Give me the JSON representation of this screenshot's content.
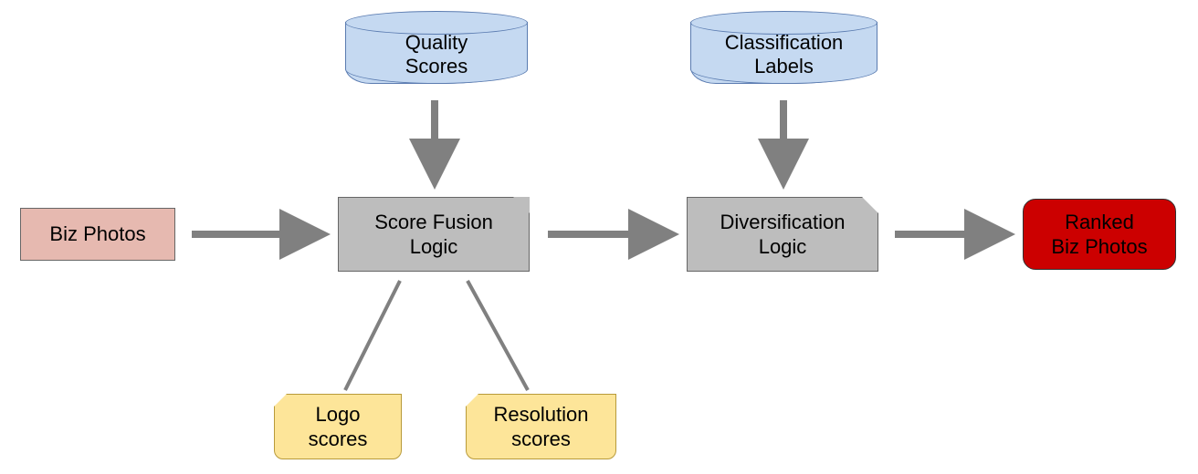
{
  "nodes": {
    "biz_photos": "Biz Photos",
    "quality_scores": "Quality\nScores",
    "classification_labels": "Classification\nLabels",
    "score_fusion": "Score Fusion\nLogic",
    "diversification": "Diversification\nLogic",
    "ranked": "Ranked\nBiz Photos",
    "logo_scores": "Logo\nscores",
    "resolution_scores": "Resolution\nscores"
  },
  "chart_data": {
    "type": "diagram",
    "nodes": [
      {
        "id": "biz_photos",
        "label": "Biz Photos",
        "shape": "rect",
        "color": "#e6b9b0"
      },
      {
        "id": "quality_scores",
        "label": "Quality Scores",
        "shape": "cylinder",
        "color": "#c5d9f1"
      },
      {
        "id": "classification_labels",
        "label": "Classification Labels",
        "shape": "cylinder",
        "color": "#c5d9f1"
      },
      {
        "id": "score_fusion",
        "label": "Score Fusion Logic",
        "shape": "process",
        "color": "#bdbdbd"
      },
      {
        "id": "diversification",
        "label": "Diversification Logic",
        "shape": "process",
        "color": "#bdbdbd"
      },
      {
        "id": "ranked",
        "label": "Ranked Biz Photos",
        "shape": "rounded-rect",
        "color": "#cc0000"
      },
      {
        "id": "logo_scores",
        "label": "Logo scores",
        "shape": "tab",
        "color": "#fde599"
      },
      {
        "id": "resolution_scores",
        "label": "Resolution scores",
        "shape": "tab",
        "color": "#fde599"
      }
    ],
    "edges": [
      {
        "from": "biz_photos",
        "to": "score_fusion",
        "arrow": true
      },
      {
        "from": "quality_scores",
        "to": "score_fusion",
        "arrow": true
      },
      {
        "from": "score_fusion",
        "to": "diversification",
        "arrow": true
      },
      {
        "from": "classification_labels",
        "to": "diversification",
        "arrow": true
      },
      {
        "from": "diversification",
        "to": "ranked",
        "arrow": true
      },
      {
        "from": "score_fusion",
        "to": "logo_scores",
        "arrow": false
      },
      {
        "from": "score_fusion",
        "to": "resolution_scores",
        "arrow": false
      }
    ]
  }
}
